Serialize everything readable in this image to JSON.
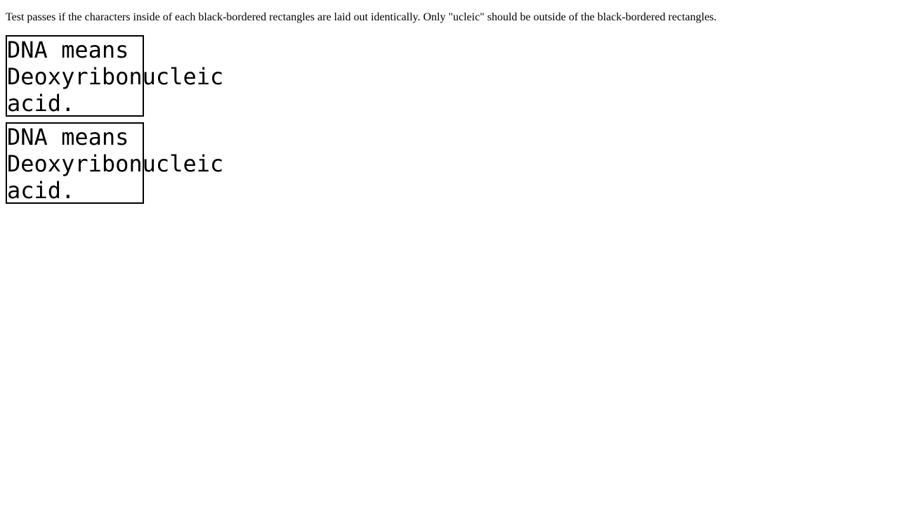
{
  "instructions": "Test passes if the characters inside of each black-bordered rectangles are laid out identically. Only \"ucleic\" should be outside of the black-bordered rectangles.",
  "test_box": {
    "line1": "DNA means",
    "line2": "Deoxyribonucleic",
    "line3": "acid."
  },
  "reference_box": {
    "line1": "DNA means",
    "line2": "Deoxyribonucleic",
    "line3": "acid."
  }
}
